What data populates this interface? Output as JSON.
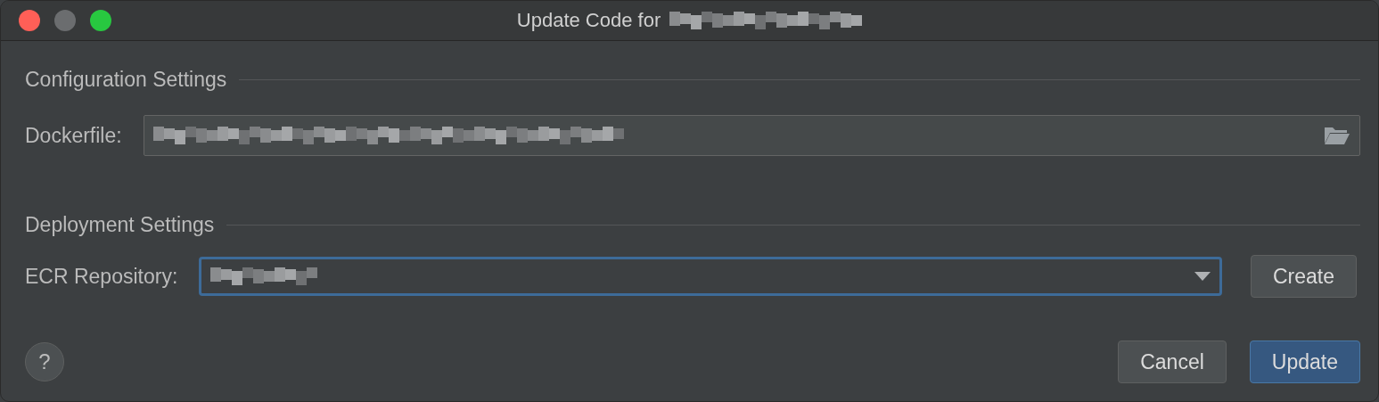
{
  "window": {
    "title": "Update Code for"
  },
  "sections": [
    {
      "title": "Configuration Settings",
      "field": {
        "kind": "file",
        "label": "Dockerfile:",
        "focused": false
      }
    },
    {
      "title": "Deployment Settings",
      "field": {
        "kind": "combo",
        "label": "ECR Repository:",
        "focused": true,
        "button": "Create"
      }
    }
  ],
  "help": "?",
  "buttons": [
    {
      "label": "Cancel",
      "primary": false
    },
    {
      "label": "Update",
      "primary": true
    }
  ]
}
